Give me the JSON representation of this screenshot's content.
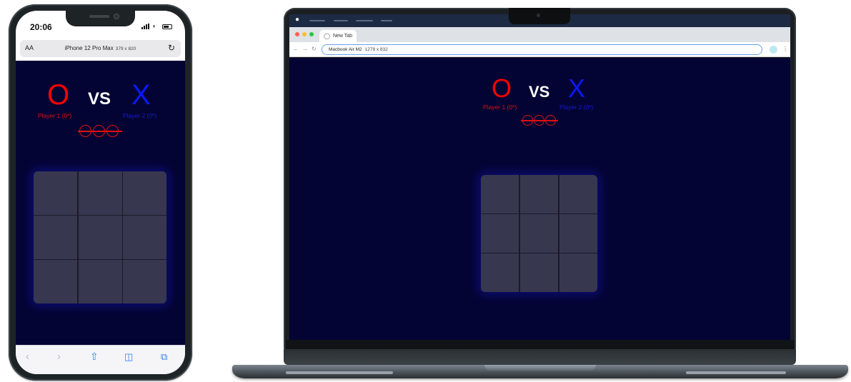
{
  "phone": {
    "status_time": "20:06",
    "aa_label": "AA",
    "device_name": "iPhone 12 Pro Max",
    "device_dims": "379 x 820",
    "reload_icon": "reload-icon",
    "toolbar_icons": [
      "back-icon",
      "forward-icon",
      "share-icon",
      "bookmarks-icon",
      "tabs-icon"
    ]
  },
  "laptop": {
    "tab_title": "New Tab",
    "address_device": "Macbook Air M2",
    "address_dims": "1278 x 832"
  },
  "game": {
    "player1_symbol": "O",
    "player2_symbol": "X",
    "vs_text": "VS",
    "player1_label": "Player 1 (0*)",
    "player2_label": "Player 2 (0*)",
    "score_marks": 3,
    "board_cells": [
      "",
      "",
      "",
      "",
      "",
      "",
      "",
      "",
      ""
    ]
  },
  "colors": {
    "background": "#040434",
    "player1": "#ff0000",
    "player2": "#0a18ff",
    "cell": "#373750"
  }
}
